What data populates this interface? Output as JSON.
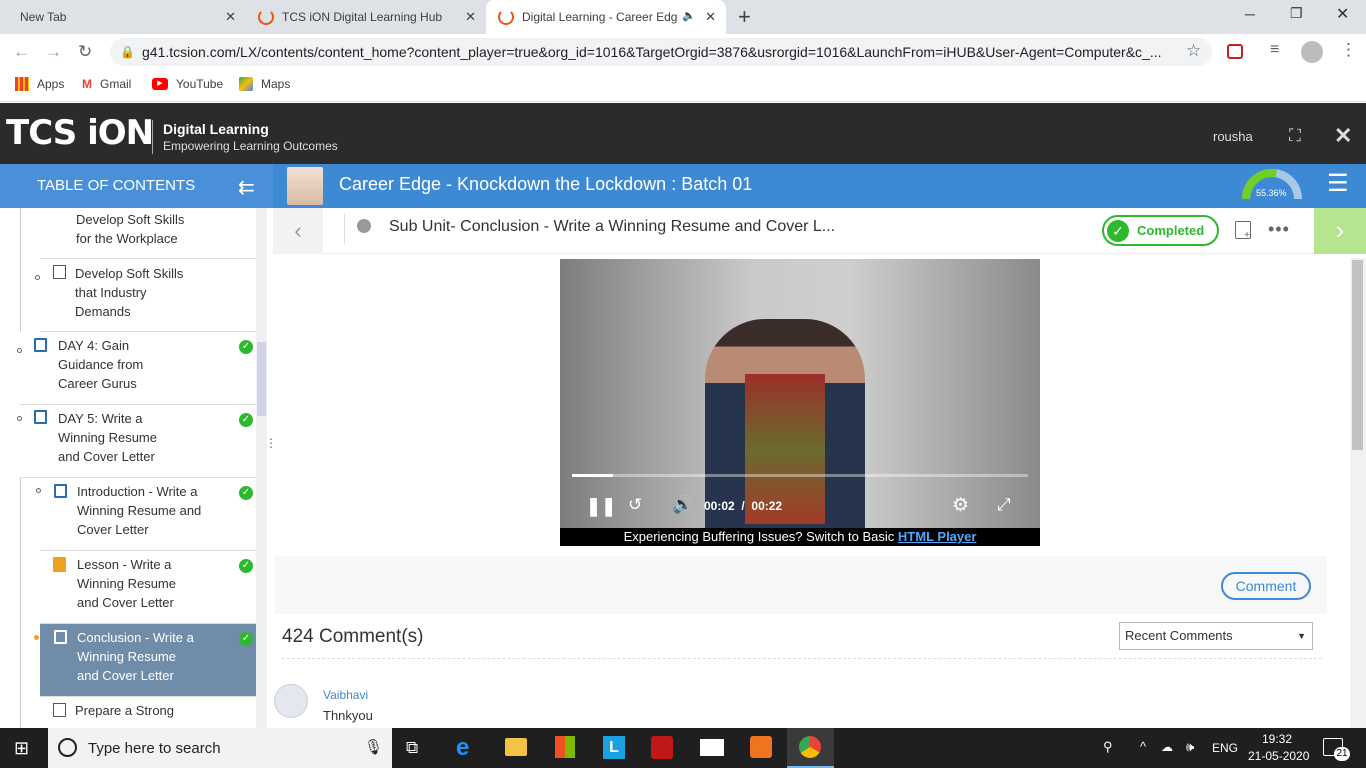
{
  "browser": {
    "tabs": [
      {
        "title": "New Tab"
      },
      {
        "title": "TCS iON Digital Learning Hub"
      },
      {
        "title": "Digital Learning - Career Edg"
      }
    ],
    "url": "g41.tcsion.com/LX/contents/content_home?content_player=true&org_id=1016&TargetOrgid=3876&usrorgid=1016&LaunchFrom=iHUB&User-Agent=Computer&c_...",
    "bookmarks": [
      "Apps",
      "Gmail",
      "YouTube",
      "Maps"
    ]
  },
  "app": {
    "brand": "TCS iON",
    "tagline_title": "Digital Learning",
    "tagline_sub": "Empowering Learning Outcomes",
    "username": "rousha"
  },
  "toc": {
    "heading": "TABLE OF CONTENTS",
    "items": [
      {
        "label": "Develop Soft Skills for the Workplace"
      },
      {
        "label": "Develop Soft Skills that Industry Demands"
      },
      {
        "label": "DAY 4: Gain Guidance from Career Gurus"
      },
      {
        "label": "DAY 5: Write a Winning Resume and Cover Letter"
      },
      {
        "label": "Introduction - Write a Winning Resume and Cover Letter"
      },
      {
        "label": "Lesson - Write a Winning Resume and Cover Letter"
      },
      {
        "label": "Conclusion - Write a Winning Resume and Cover Letter"
      },
      {
        "label": "Prepare a Strong"
      }
    ]
  },
  "course": {
    "title": "Career Edge - Knockdown the Lockdown : Batch 01",
    "progress_label": "55.36%",
    "progress": 0.5536
  },
  "subunit": {
    "title": "Sub Unit- Conclusion - Write a Winning Resume and Cover L...",
    "status": "Completed"
  },
  "video": {
    "current_time": "00:02",
    "separator": "/",
    "duration": "00:22",
    "progress": 0.09,
    "buffering_text": "Experiencing Buffering Issues? Switch to Basic",
    "html_player_link": "HTML Player"
  },
  "comments": {
    "comment_button": "Comment",
    "count_label": "424 Comment(s)",
    "sort_selected": "Recent Comments",
    "list": [
      {
        "author": "Vaibhavi",
        "text": "Thnkyou"
      }
    ]
  },
  "taskbar": {
    "search_placeholder": "Type here to search",
    "language": "ENG",
    "time": "19:32",
    "date": "21-05-2020",
    "notifications": "21"
  }
}
